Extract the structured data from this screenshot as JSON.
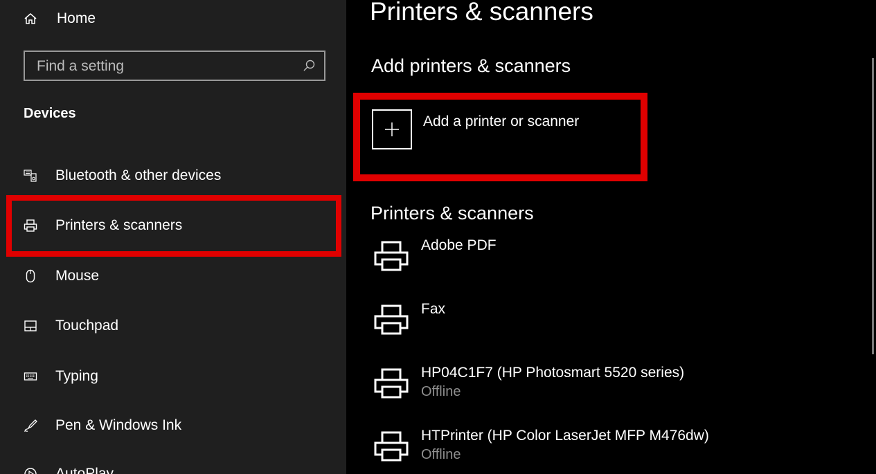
{
  "sidebar": {
    "home_label": "Home",
    "search": {
      "placeholder": "Find a setting"
    },
    "section_title": "Devices",
    "items": [
      {
        "label": "Bluetooth & other devices",
        "icon": "bluetooth-devices-icon"
      },
      {
        "label": "Printers & scanners",
        "icon": "printer-icon",
        "selected": true
      },
      {
        "label": "Mouse",
        "icon": "mouse-icon"
      },
      {
        "label": "Touchpad",
        "icon": "touchpad-icon"
      },
      {
        "label": "Typing",
        "icon": "keyboard-icon"
      },
      {
        "label": "Pen & Windows Ink",
        "icon": "pen-icon"
      },
      {
        "label": "AutoPlay",
        "icon": "autoplay-icon"
      }
    ]
  },
  "main": {
    "page_title": "Printers & scanners",
    "add_section_title": "Add printers & scanners",
    "add_button_label": "Add a printer or scanner",
    "list_title": "Printers & scanners",
    "printers": [
      {
        "name": "Adobe PDF",
        "status": ""
      },
      {
        "name": "Fax",
        "status": ""
      },
      {
        "name": "HP04C1F7 (HP Photosmart 5520 series)",
        "status": "Offline"
      },
      {
        "name": "HTPrinter (HP Color LaserJet MFP M476dw)",
        "status": "Offline"
      }
    ]
  },
  "colors": {
    "highlight": "#e00000",
    "sidebar_bg": "#1f1f1f",
    "main_bg": "#000000",
    "status_gray": "#8f8f8f"
  }
}
